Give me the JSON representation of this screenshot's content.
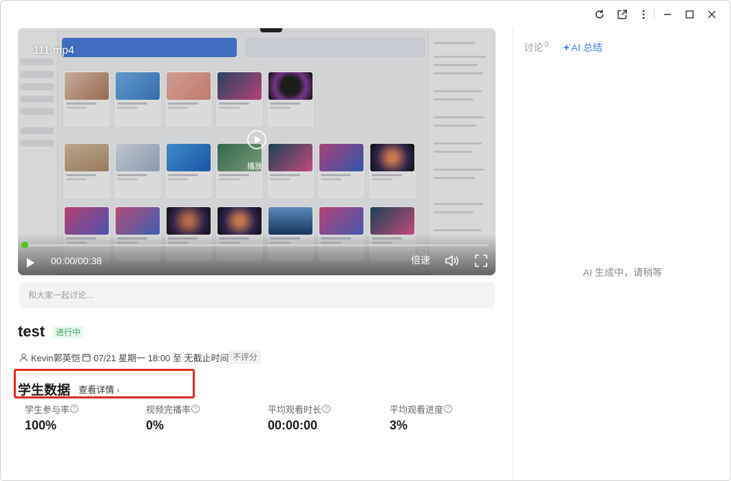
{
  "titlebar": {
    "icons": [
      "refresh-icon",
      "share-external-icon",
      "more-vertical-icon",
      "minimize-icon",
      "maximize-icon",
      "close-icon"
    ]
  },
  "video": {
    "title": "111.mp4",
    "center_label": "播放",
    "time": "00:00/00:38",
    "speed_label": "倍速",
    "progress": 0
  },
  "discussion_input": {
    "placeholder": "和大家一起讨论..."
  },
  "task": {
    "title": "test",
    "status": "进行中",
    "teacher": "Kevin郭英恺",
    "schedule": "07/21 星期一 18:00 至 无截止时间",
    "grading": "不评分"
  },
  "student_data": {
    "title": "学生数据",
    "detail_link": "查看详情",
    "stats": [
      {
        "label": "学生参与率",
        "value": "100%"
      },
      {
        "label": "视频完播率",
        "value": "0%"
      },
      {
        "label": "平均观看时长",
        "value": "00:00:00"
      },
      {
        "label": "平均观看进度",
        "value": "3%"
      }
    ]
  },
  "right_panel": {
    "tab_discuss": "讨论",
    "tab_discuss_count": "0",
    "tab_ai": "AI 总结",
    "ai_status": "AI 生成中，请稍等"
  },
  "colors": {
    "accent_blue": "#3a7bf2",
    "status_green": "#3aa55c",
    "highlight_red": "#e3261f",
    "progress_green": "#52c41a"
  }
}
